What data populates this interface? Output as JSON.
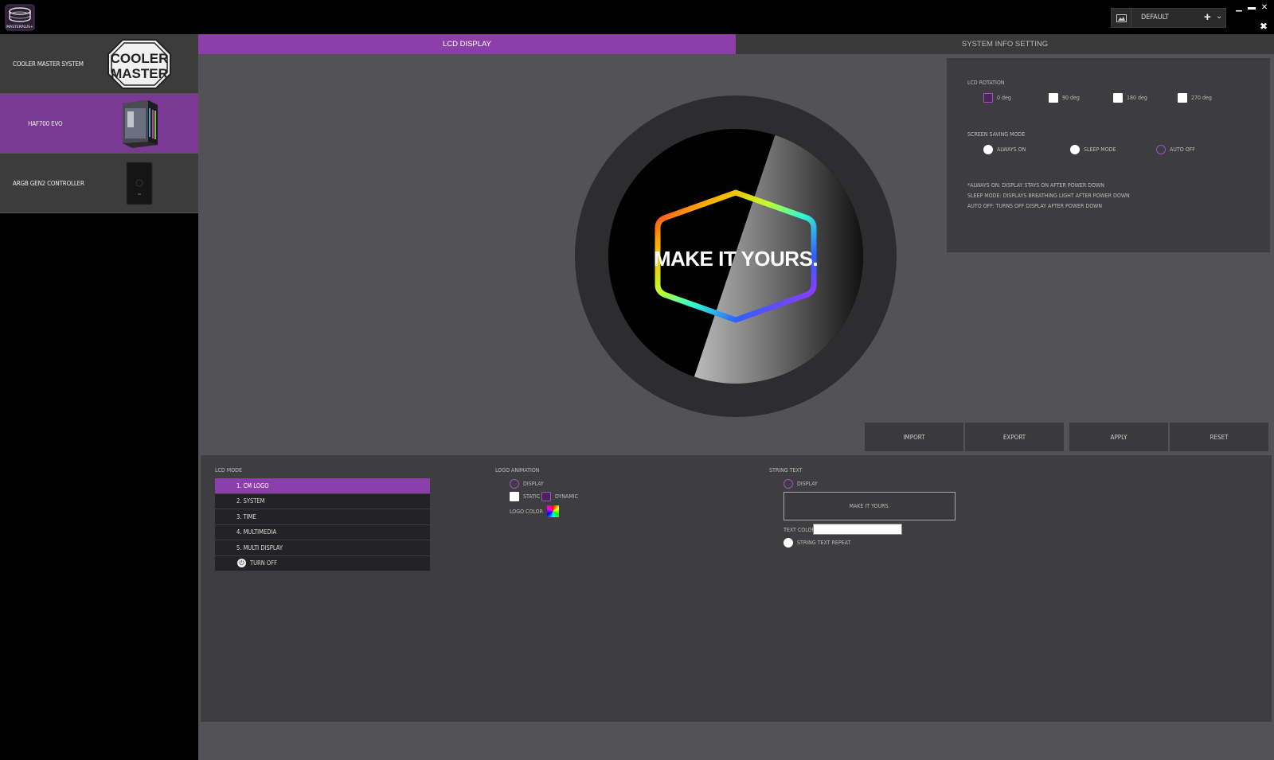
{
  "app": {
    "logo_text": "MASTERPLUS+"
  },
  "profile": {
    "name": "DEFAULT"
  },
  "sidebar": {
    "devices": [
      {
        "label": "COOLER MASTER SYSTEM",
        "logo_text_1": "COOLER",
        "logo_text_2": "MASTER"
      },
      {
        "label": "HAF700 EVO"
      },
      {
        "label": "ARGB GEN2 CONTROLLER"
      }
    ]
  },
  "tabs": [
    {
      "label": "LCD DISPLAY"
    },
    {
      "label": "SYSTEM INFO SETTING"
    }
  ],
  "preview": {
    "text": "MAKE IT YOURS."
  },
  "settings": {
    "rotation_title": "LCD ROTATION",
    "rotation_options": [
      "0 deg",
      "90 deg",
      "180 deg",
      "270 deg"
    ],
    "rotation_selected": "0 deg",
    "saving_title": "SCREEN SAVING MODE",
    "saving_options": [
      "ALWAYS ON",
      "SLEEP MODE",
      "AUTO OFF"
    ],
    "saving_selected": "AUTO OFF",
    "notes": [
      "*ALWAYS ON: DISPLAY STAYS ON AFTER POWER DOWN",
      "SLEEP MODE: DISPLAYS BREATHING LIGHT AFTER POWER DOWN",
      "AUTO OFF: TURNS OFF DISPLAY AFTER POWER DOWN"
    ]
  },
  "actions": {
    "import": "IMPORT",
    "export": "EXPORT",
    "apply": "APPLY",
    "reset": "RESET"
  },
  "lcd_mode": {
    "title": "LCD MODE",
    "items": [
      "1. CM LOGO",
      "2. SYSTEM",
      "3. TIME",
      "4. MULTIMEDIA",
      "5. MULTI DISPLAY",
      "TURN OFF"
    ],
    "selected": "1. CM LOGO"
  },
  "logo_animation": {
    "title": "LOGO ANIMATION",
    "display_label": "DISPLAY",
    "static_label": "STATIC",
    "dynamic_label": "DYNAMIC",
    "color_label": "LOGO COLOR"
  },
  "string_text": {
    "title": "STRING TEXT",
    "display_label": "DISPLAY",
    "value": "MAKE IT YOURS.",
    "text_color_label": "TEXT COLOR",
    "text_color": "#ffffff",
    "repeat_label": "STRING TEXT REPEAT"
  },
  "colors": {
    "accent": "#8c3fa8",
    "panel": "#3e3e40",
    "main_bg": "#525257"
  }
}
